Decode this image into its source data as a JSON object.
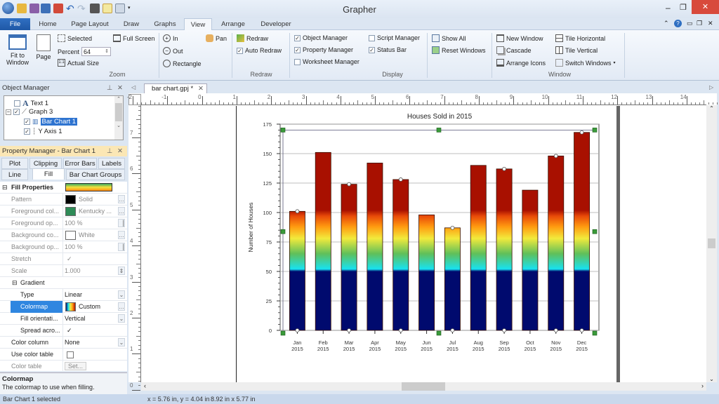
{
  "app": {
    "title": "Grapher"
  },
  "quick_access": [
    "app-menu-icon",
    "open-icon",
    "save-icon",
    "save-as-icon",
    "export-icon",
    "undo-icon",
    "redo-icon",
    "print-icon",
    "new-icon",
    "new-window-icon",
    "customize-dropdown-icon"
  ],
  "window_controls": {
    "minimize": "–",
    "restore": "❐",
    "close": "✕"
  },
  "ribbon_tabs": [
    {
      "label": "File"
    },
    {
      "label": "Home"
    },
    {
      "label": "Page Layout"
    },
    {
      "label": "Draw"
    },
    {
      "label": "Graphs"
    },
    {
      "label": "View",
      "active": true
    },
    {
      "label": "Arrange"
    },
    {
      "label": "Developer"
    }
  ],
  "ribbon": {
    "zoom": {
      "group_label": "Zoom",
      "fit_to_window": "Fit to Window",
      "page": "Page",
      "selected": "Selected",
      "percent_label": "Percent",
      "percent_value": "64",
      "actual_size": "Actual Size",
      "full_screen": "Full Screen",
      "in": "In",
      "out": "Out",
      "rectangle": "Rectangle",
      "pan": "Pan"
    },
    "redraw": {
      "group_label": "Redraw",
      "redraw": "Redraw",
      "auto_redraw": "Auto Redraw",
      "auto_redraw_checked": true
    },
    "display": {
      "group_label": "Display",
      "object_manager": "Object Manager",
      "property_manager": "Property Manager",
      "worksheet_manager": "Worksheet Manager",
      "script_manager": "Script Manager",
      "status_bar": "Status Bar",
      "show_all": "Show All",
      "reset_windows": "Reset Windows"
    },
    "window": {
      "group_label": "Window",
      "new_window": "New Window",
      "cascade": "Cascade",
      "arrange_icons": "Arrange Icons",
      "tile_horizontal": "Tile Horizontal",
      "tile_vertical": "Tile Vertical",
      "switch_windows": "Switch Windows"
    }
  },
  "object_manager": {
    "title": "Object Manager",
    "items": [
      {
        "label": "Text 1",
        "checked": false
      },
      {
        "label": "Graph 3",
        "checked": true
      },
      {
        "label": "Bar Chart 1",
        "checked": true,
        "selected": true
      },
      {
        "label": "Y Axis 1",
        "checked": true
      }
    ]
  },
  "property_manager": {
    "title": "Property Manager - Bar Chart 1",
    "tabs_row1": [
      "Plot",
      "Clipping",
      "Error Bars",
      "Labels"
    ],
    "tabs_row2": [
      "Line",
      "Fill",
      "Bar Chart Groups"
    ],
    "active_tab": "Fill",
    "section": "Fill Properties",
    "rows": [
      {
        "name": "Pattern",
        "value": "Solid"
      },
      {
        "name": "Foreground col...",
        "value": "Kentucky ..."
      },
      {
        "name": "Foreground op...",
        "value": "100 %"
      },
      {
        "name": "Background co...",
        "value": "White"
      },
      {
        "name": "Background op...",
        "value": "100 %"
      },
      {
        "name": "Stretch",
        "value": "✓"
      },
      {
        "name": "Scale",
        "value": "1.000"
      }
    ],
    "gradient": {
      "label": "Gradient",
      "rows": [
        {
          "name": "Type",
          "value": "Linear"
        },
        {
          "name": "Colormap",
          "value": "Custom"
        },
        {
          "name": "Fill orientati...",
          "value": "Vertical"
        },
        {
          "name": "Spread acro...",
          "value": "✓"
        }
      ]
    },
    "rows2": [
      {
        "name": "Color column",
        "value": "None"
      },
      {
        "name": "Use color table",
        "value": ""
      },
      {
        "name": "Color table",
        "value": "Set..."
      }
    ],
    "colors": {
      "foreground": "#2e8b57",
      "pattern": "#000000",
      "background": "#ffffff"
    },
    "description": {
      "title": "Colormap",
      "text": "The colormap to use when filling."
    }
  },
  "document": {
    "tab_label": "bar chart.gpj *",
    "h_ruler": [
      "-2",
      "-1",
      "0",
      "1",
      "2",
      "3",
      "4",
      "5",
      "6",
      "7",
      "8",
      "9",
      "10",
      "11",
      "12",
      "13",
      "14"
    ],
    "v_ruler": [
      "7",
      "6",
      "5",
      "4",
      "3",
      "2",
      "1",
      "0"
    ]
  },
  "status": {
    "selection": "Bar Chart 1 selected",
    "cursor": "x = 5.76 in, y = 4.04 in",
    "size": "8.92 in x 5.77 in"
  },
  "chart_data": {
    "type": "bar",
    "title": "Houses Sold in 2015",
    "xlabel": "",
    "ylabel": "Number of Houses",
    "categories": [
      "Jan 2015",
      "Feb 2015",
      "Mar 2015",
      "Apr 2015",
      "May 2015",
      "Jun 2015",
      "Jul 2015",
      "Aug 2015",
      "Sep 2015",
      "Oct 2015",
      "Nov 2015",
      "Dec 2015"
    ],
    "values": [
      101,
      151,
      124,
      142,
      128,
      98,
      87,
      140,
      137,
      119,
      148,
      168
    ],
    "ylim": [
      0,
      175
    ],
    "yticks": [
      0,
      25,
      50,
      75,
      100,
      125,
      150,
      175
    ],
    "grid": true,
    "legend": "none",
    "colormap": [
      {
        "value": 0,
        "color": "#000a6e"
      },
      {
        "value": 50,
        "color": "#000a6e"
      },
      {
        "value": 52,
        "color": "#18e2f0"
      },
      {
        "value": 65,
        "color": "#5fbf5a"
      },
      {
        "value": 78,
        "color": "#f2ea3c"
      },
      {
        "value": 88,
        "color": "#ff9a10"
      },
      {
        "value": 97,
        "color": "#e84a08"
      },
      {
        "value": 102,
        "color": "#a81000"
      },
      {
        "value": 175,
        "color": "#a81000"
      }
    ]
  }
}
